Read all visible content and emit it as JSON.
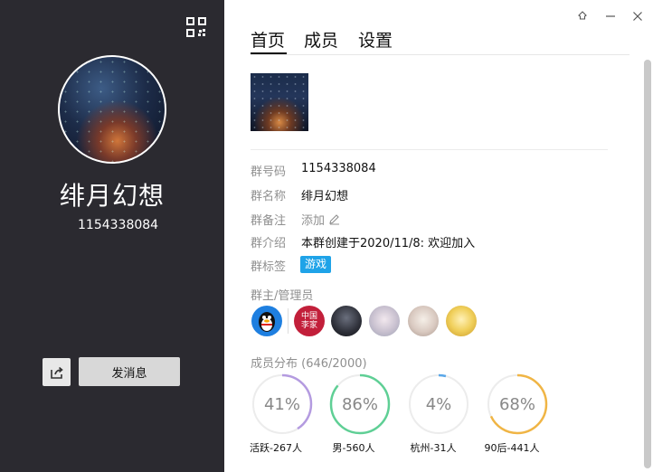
{
  "left": {
    "group_name": "绯月幻想",
    "group_number": "1154338084",
    "send_message_label": "发消息"
  },
  "tabs": [
    {
      "label": "首页",
      "active": true
    },
    {
      "label": "成员",
      "active": false
    },
    {
      "label": "设置",
      "active": false
    }
  ],
  "info": {
    "number_label": "群号码",
    "number_value": "1154338084",
    "name_label": "群名称",
    "name_value": "绯月幻想",
    "remark_label": "群备注",
    "remark_value": "添加",
    "intro_label": "群介绍",
    "intro_value": "本群创建于2020/11/8:  欢迎加入",
    "tag_label": "群标签",
    "tag_value": "游戏"
  },
  "admins": {
    "title": "群主/管理员",
    "avatar2_text_line1": "中国",
    "avatar2_text_line2": "李家"
  },
  "distribution": {
    "title": "成员分布 (646/2000)",
    "stats": [
      {
        "percent_label": "41%",
        "fraction": 0.41,
        "label": "活跃-267人",
        "color": "#b49be0"
      },
      {
        "percent_label": "86%",
        "fraction": 0.86,
        "label": "男-560人",
        "color": "#5fcf95"
      },
      {
        "percent_label": "4%",
        "fraction": 0.04,
        "label": "杭州-31人",
        "color": "#5aa7e8"
      },
      {
        "percent_label": "68%",
        "fraction": 0.68,
        "label": "90后-441人",
        "color": "#f0b545"
      }
    ]
  },
  "colors": {
    "sidebar_bg": "#2b2a30",
    "tag_bg": "#1fa3e8"
  }
}
